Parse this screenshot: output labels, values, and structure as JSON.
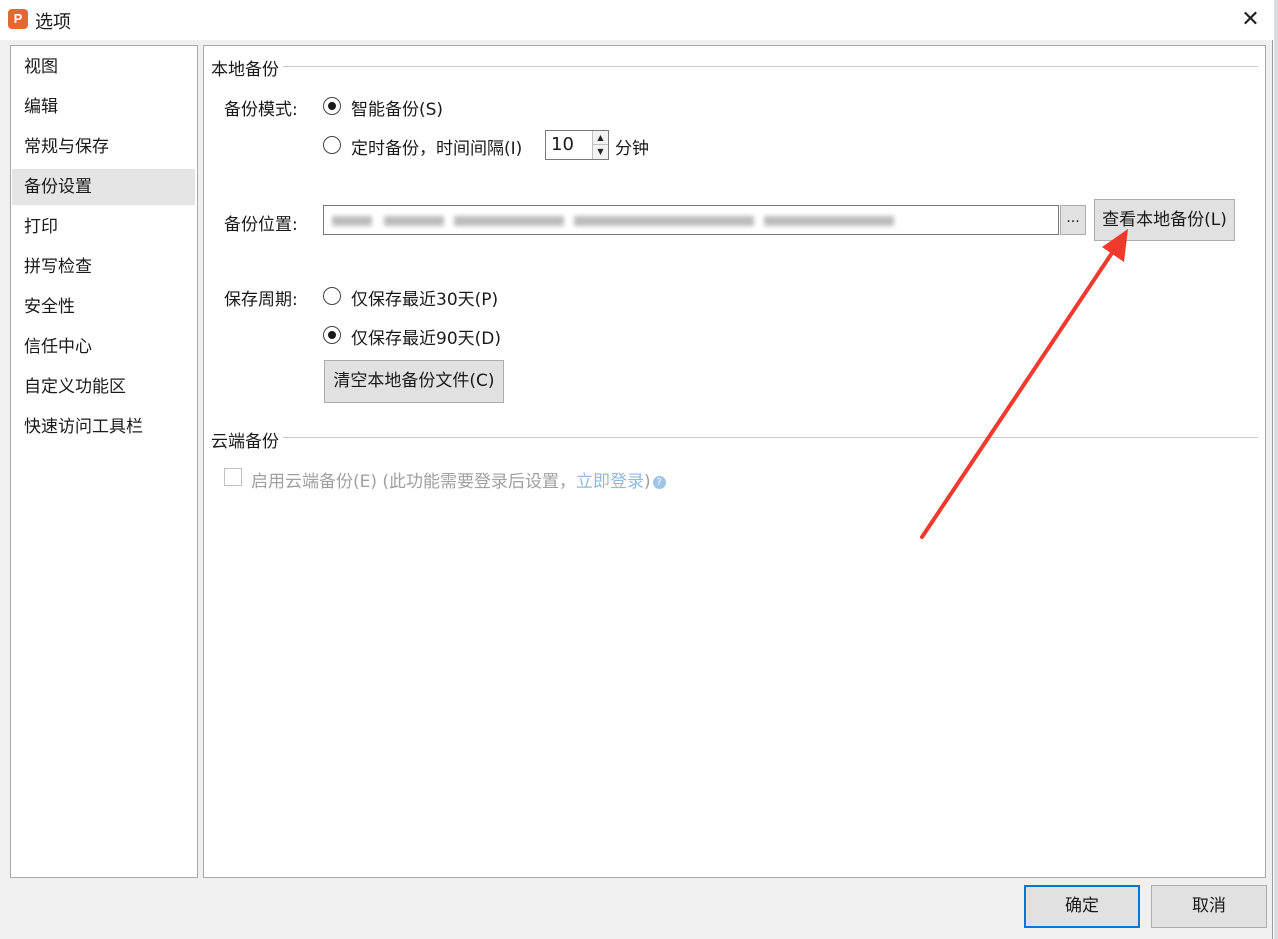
{
  "window": {
    "title": "选项",
    "app_icon_letter": "P",
    "close_symbol": "✕"
  },
  "sidebar": {
    "items": [
      {
        "label": "视图"
      },
      {
        "label": "编辑"
      },
      {
        "label": "常规与保存"
      },
      {
        "label": "备份设置"
      },
      {
        "label": "打印"
      },
      {
        "label": "拼写检查"
      },
      {
        "label": "安全性"
      },
      {
        "label": "信任中心"
      },
      {
        "label": "自定义功能区"
      },
      {
        "label": "快速访问工具栏"
      }
    ],
    "selected": "备份设置"
  },
  "local_backup": {
    "section_title": "本地备份",
    "mode_label": "备份模式:",
    "mode_smart": "智能备份(S)",
    "mode_timed": "定时备份，时间间隔(I)",
    "mode_selected": "smart",
    "interval_value": "10",
    "interval_unit": "分钟",
    "location_label": "备份位置:",
    "browse_label": "...",
    "view_backup_button": "查看本地备份(L)",
    "period_label": "保存周期:",
    "period_30": "仅保存最近30天(P)",
    "period_90": "仅保存最近90天(D)",
    "period_selected": "90",
    "clear_button": "清空本地备份文件(C)"
  },
  "cloud_backup": {
    "section_title": "云端备份",
    "enable_label": "启用云端备份(E) (此功能需要登录后设置，",
    "login_link": "立即登录",
    "close_paren": ")",
    "help_symbol": "?",
    "enabled": false
  },
  "footer": {
    "ok_label": "确定",
    "cancel_label": "取消"
  },
  "colors": {
    "annotation_arrow": "#f03a2e",
    "default_button_border": "#0078d7",
    "link": "#8fb9e0"
  },
  "icons": {
    "app": "wps-presentation-icon",
    "close": "close-icon",
    "spin_up": "triangle-up-icon",
    "spin_down": "triangle-down-icon",
    "help": "help-circle-icon"
  }
}
